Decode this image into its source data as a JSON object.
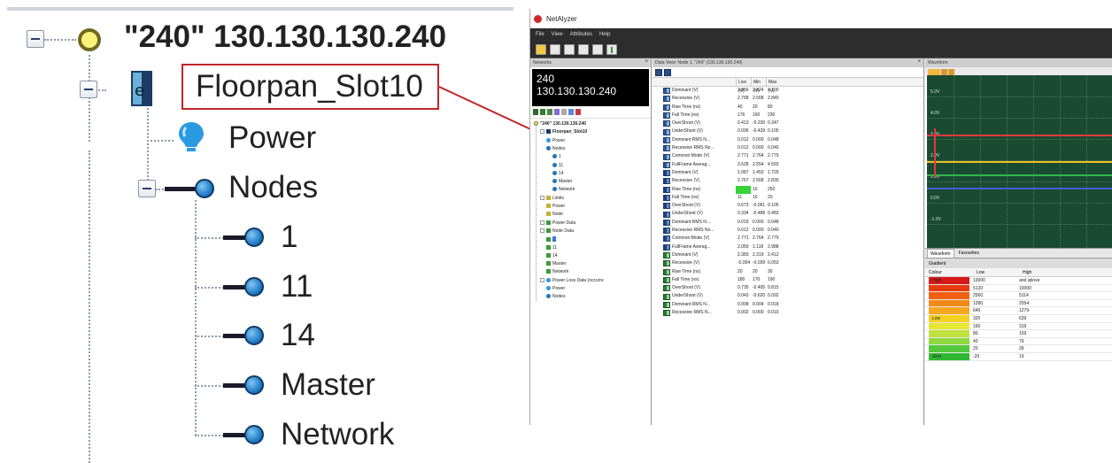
{
  "zoom_tree": {
    "root_label": "\"240\" 130.130.130.240",
    "module_label": "Floorpan_Slot10",
    "power_label": "Power",
    "nodes_label": "Nodes",
    "node_items": [
      "1",
      "11",
      "14",
      "Master",
      "Network"
    ]
  },
  "app": {
    "window_title": "NetAlyzer",
    "menu": [
      "File",
      "View",
      "Attributes",
      "Help"
    ],
    "network_header": "Networks",
    "device_name": "240",
    "device_ip": "130.130.130.240",
    "tree": [
      {
        "label": "\"240\" 130.130.130.240",
        "indent": 0,
        "bold": true,
        "icon": "node-circle-icon"
      },
      {
        "label": "Floorpan_Slot10",
        "indent": 1,
        "bold": true,
        "icon": "module-icon"
      },
      {
        "label": "Power",
        "indent": 2,
        "icon": "bulb-icon"
      },
      {
        "label": "Nodes",
        "indent": 2,
        "icon": "node-icon"
      },
      {
        "label": "1",
        "indent": 3,
        "icon": "node-icon"
      },
      {
        "label": "11",
        "indent": 3,
        "icon": "node-icon"
      },
      {
        "label": "14",
        "indent": 3,
        "icon": "node-icon"
      },
      {
        "label": "Master",
        "indent": 3,
        "icon": "node-icon"
      },
      {
        "label": "Network",
        "indent": 3,
        "icon": "node-icon"
      },
      {
        "label": "Limits",
        "indent": 1,
        "icon": "limits-icon"
      },
      {
        "label": "Power",
        "indent": 2,
        "icon": "limits-icon"
      },
      {
        "label": "Node",
        "indent": 2,
        "icon": "limits-icon"
      },
      {
        "label": "Power Data",
        "indent": 1,
        "icon": "data-icon"
      },
      {
        "label": "Node Data",
        "indent": 1,
        "icon": "data-icon"
      },
      {
        "label": "",
        "indent": 2,
        "icon": "data-icon",
        "selected": true
      },
      {
        "label": "11",
        "indent": 2,
        "icon": "data-icon"
      },
      {
        "label": "14",
        "indent": 2,
        "icon": "data-icon"
      },
      {
        "label": "Master",
        "indent": 2,
        "icon": "data-icon"
      },
      {
        "label": "Network",
        "indent": 2,
        "icon": "data-icon"
      },
      {
        "label": "Power Loss Data (occurre",
        "indent": 1,
        "icon": "bulb-icon"
      },
      {
        "label": "Power",
        "indent": 2,
        "icon": "bulb-icon"
      },
      {
        "label": "Nodes",
        "indent": 2,
        "icon": "node-icon"
      }
    ],
    "data_view": {
      "title": "Data View: Node 1, \"240\" (130.130.130.240)",
      "columns": [
        "",
        "Live (V)",
        "Min (V)",
        "Max (V)"
      ],
      "rows": [
        {
          "name": "Dominant (V)",
          "live": "3.856",
          "min": "3.824",
          "max": "4.100",
          "icon": "blue"
        },
        {
          "name": "Recessive (V)",
          "live": "2.768",
          "min": "2.568",
          "max": "2.840",
          "icon": "blue"
        },
        {
          "name": "Rise Time (ns)",
          "live": "40",
          "min": "20",
          "max": "80",
          "icon": "blue"
        },
        {
          "name": "Fall Time (ns)",
          "live": "176",
          "min": "160",
          "max": "230",
          "icon": "blue"
        },
        {
          "name": "OverShoot (V)",
          "live": "0.413",
          "min": "-0.230",
          "max": "0.347",
          "icon": "blue"
        },
        {
          "name": "UnderShoot (V)",
          "live": "0.036",
          "min": "-0.439",
          "max": "0.105",
          "icon": "blue"
        },
        {
          "name": "Dominant RMS N...",
          "live": "0.012",
          "min": "0.000",
          "max": "0.048",
          "icon": "blue"
        },
        {
          "name": "Recessive RMS No...",
          "live": "0.012",
          "min": "0.000",
          "max": "0.040",
          "icon": "blue"
        },
        {
          "name": "Common Mode (V)",
          "live": "2.771",
          "min": "2.764",
          "max": "2.779",
          "icon": "blue"
        },
        {
          "name": "FullFrame Averag...",
          "live": "3.528",
          "min": "2.554",
          "max": "4.593",
          "icon": "blue"
        },
        {
          "name": "Dominant (V)",
          "live": "1.087",
          "min": "1.450",
          "max": "1.729",
          "icon": "dark"
        },
        {
          "name": "Recessive (V)",
          "live": "2.767",
          "min": "2.568",
          "max": "2.830",
          "icon": "dark"
        },
        {
          "name": "Rise Time (ns)",
          "live": "",
          "min": "10",
          "max": "250",
          "icon": "dark",
          "live_highlight": true
        },
        {
          "name": "Fall Time (ns)",
          "live": "11",
          "min": "10",
          "max": "20",
          "icon": "dark"
        },
        {
          "name": "OverShoot (V)",
          "live": "0.673",
          "min": "-0.061",
          "max": "0.105",
          "icon": "dark"
        },
        {
          "name": "UnderShoot (V)",
          "live": "0.334",
          "min": "-0.488",
          "max": "0.483",
          "icon": "dark"
        },
        {
          "name": "Dominant RMS N...",
          "live": "0.019",
          "min": "0.000",
          "max": "0.048",
          "icon": "dark"
        },
        {
          "name": "Recessive RMS No...",
          "live": "0.012",
          "min": "0.000",
          "max": "0.040",
          "icon": "dark"
        },
        {
          "name": "Common Mode (V)",
          "live": "2.771",
          "min": "2.764",
          "max": "2.779",
          "icon": "dark"
        },
        {
          "name": "FullFrame Averag...",
          "live": "2.050",
          "min": "1.118",
          "max": "2.988",
          "icon": "dark"
        },
        {
          "name": "Dominant (V)",
          "live": "2.383",
          "min": "2.319",
          "max": "2.412",
          "icon": "green"
        },
        {
          "name": "Recessive (V)",
          "live": "-0.004",
          "min": "-0.039",
          "max": "0.053",
          "icon": "green"
        },
        {
          "name": "Rise Time (ns)",
          "live": "20",
          "min": "20",
          "max": "30",
          "icon": "green"
        },
        {
          "name": "Fall Time (ns)",
          "live": "180",
          "min": "170",
          "max": "190",
          "icon": "green"
        },
        {
          "name": "OverShoot (V)",
          "live": "0.735",
          "min": "-0.405",
          "max": "0.815",
          "icon": "green"
        },
        {
          "name": "UnderShoot (V)",
          "live": "0.043",
          "min": "-0.620",
          "max": "0.092",
          "icon": "green"
        },
        {
          "name": "Dominant RMS N...",
          "live": "0.008",
          "min": "0.004",
          "max": "0.018",
          "icon": "green"
        },
        {
          "name": "Recessive RMS N...",
          "live": "0.002",
          "min": "0.000",
          "max": "0.010",
          "icon": "green"
        }
      ]
    },
    "waveform": {
      "title": "Waveform",
      "y_labels": [
        "5.0V",
        "4.0V",
        "3.0V",
        "2.0V",
        "1.0V",
        "0.0V",
        "-1.0V"
      ],
      "bottom_tabs": [
        "Waveform",
        "Favourites"
      ],
      "trace_colors": [
        "#e03a3a",
        "#f0c020",
        "#2fb84a",
        "#4060d0"
      ]
    },
    "gradient": {
      "title": "Gradient",
      "columns": [
        "Colour",
        "Low",
        "High"
      ],
      "rows": [
        {
          "swatch_label": "High",
          "color": "#d81818",
          "low": "10000",
          "high": "and above"
        },
        {
          "swatch_label": "",
          "color": "#e83a10",
          "low": "5120",
          "high": "10000"
        },
        {
          "swatch_label": "",
          "color": "#f06010",
          "low": "2560",
          "high": "5114"
        },
        {
          "swatch_label": "",
          "color": "#f58a18",
          "low": "1280",
          "high": "2554"
        },
        {
          "swatch_label": "",
          "color": "#f8a820",
          "low": "640",
          "high": "1279"
        },
        {
          "swatch_label": "Low",
          "color": "#f4d020",
          "low": "320",
          "high": "639"
        },
        {
          "swatch_label": "",
          "color": "#e6e830",
          "low": "160",
          "high": "319"
        },
        {
          "swatch_label": "",
          "color": "#c2e040",
          "low": "80",
          "high": "159"
        },
        {
          "swatch_label": "",
          "color": "#8ed840",
          "low": "40",
          "high": "79"
        },
        {
          "swatch_label": "",
          "color": "#52c83a",
          "low": "20",
          "high": "39"
        },
        {
          "swatch_label": "Zero",
          "color": "#2fb830",
          "low": "-20",
          "high": "19"
        }
      ]
    }
  }
}
